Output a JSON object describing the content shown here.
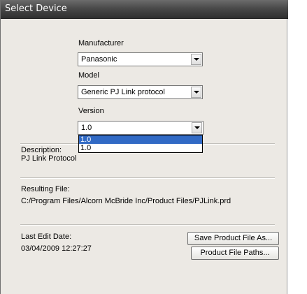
{
  "window": {
    "title": "Select Device"
  },
  "manufacturer": {
    "label": "Manufacturer",
    "value": "Panasonic"
  },
  "model": {
    "label": "Model",
    "value": "Generic PJ Link protocol"
  },
  "version": {
    "label": "Version",
    "value": "1.0",
    "options": [
      "1.0",
      "1.0"
    ]
  },
  "description": {
    "label": "Description:",
    "value": "PJ Link Protocol"
  },
  "resulting_file": {
    "label": "Resulting File:",
    "value": "C:/Program Files/Alcorn McBride Inc/Product Files/PJLink.prd"
  },
  "last_edit": {
    "label": "Last Edit Date:",
    "value": "03/04/2009 12:27:27"
  },
  "buttons": {
    "save_as": "Save Product File As...",
    "paths": "Product File Paths..."
  }
}
